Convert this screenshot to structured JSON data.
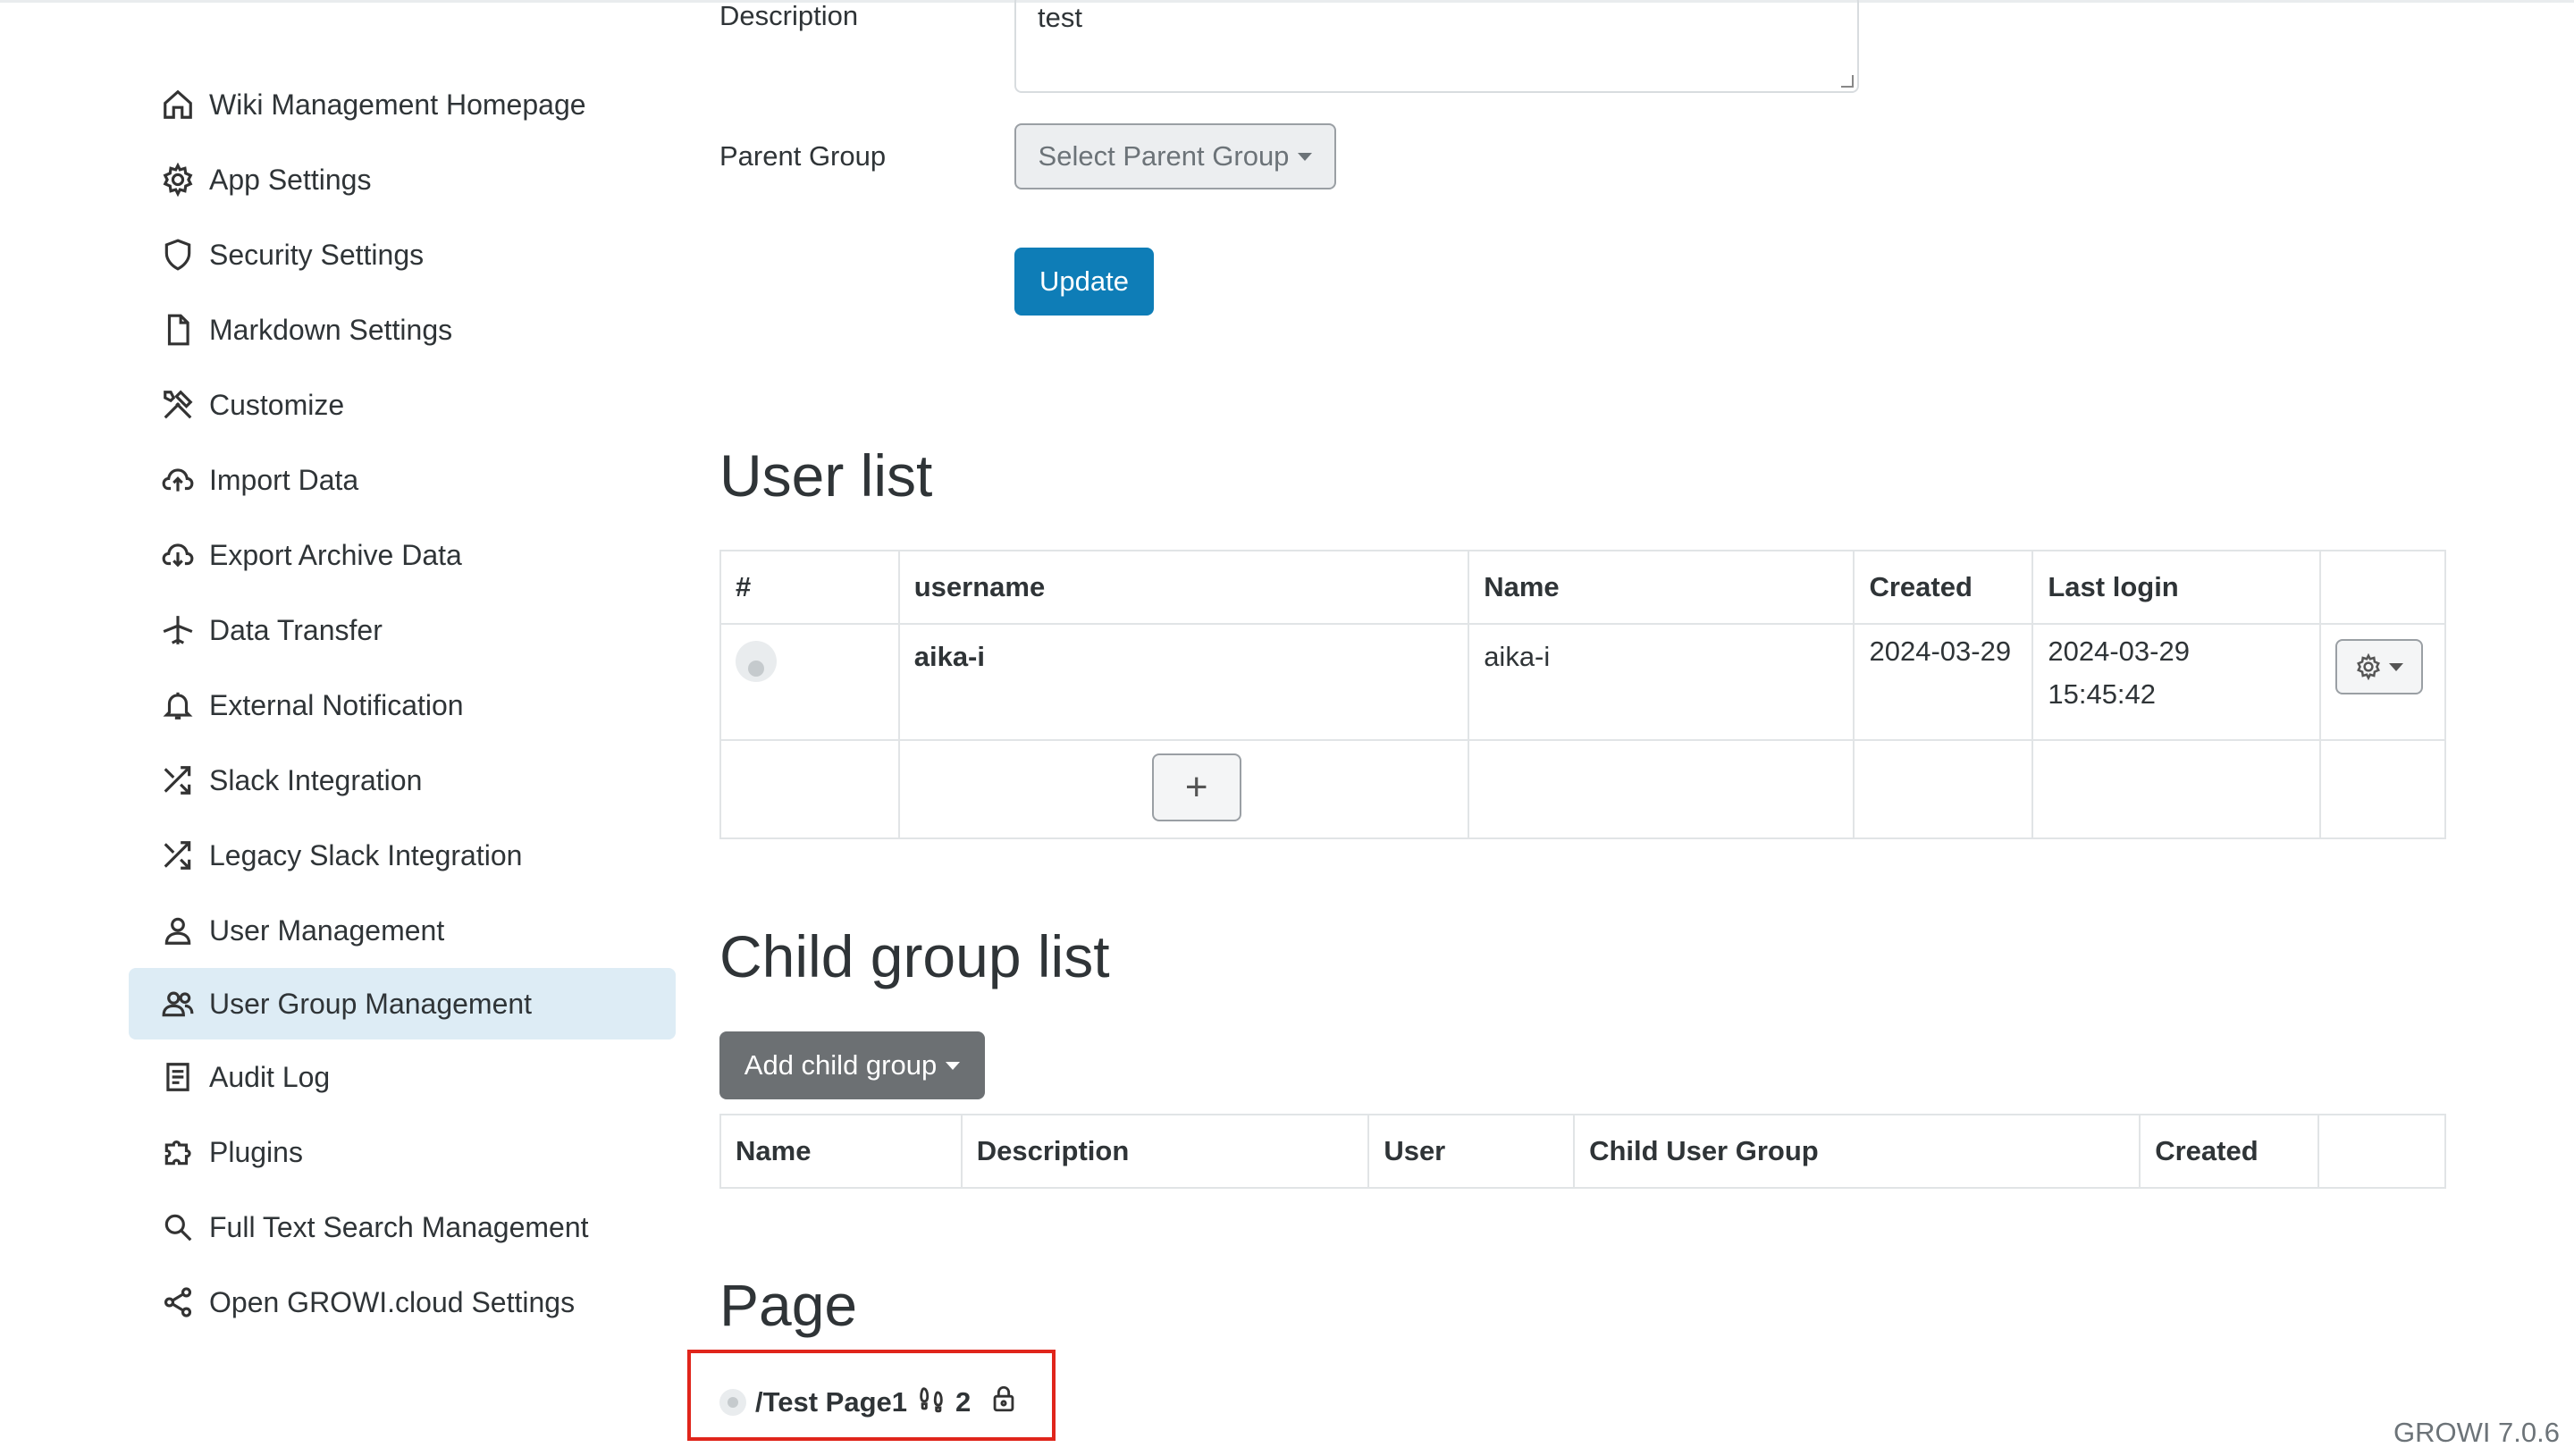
{
  "sidebar": {
    "items": [
      {
        "label": "Wiki Management Homepage",
        "icon": "home-icon"
      },
      {
        "label": "App Settings",
        "icon": "gear-icon"
      },
      {
        "label": "Security Settings",
        "icon": "shield-icon"
      },
      {
        "label": "Markdown Settings",
        "icon": "file-icon"
      },
      {
        "label": "Customize",
        "icon": "tools-icon"
      },
      {
        "label": "Import Data",
        "icon": "cloud-upload-icon"
      },
      {
        "label": "Export Archive Data",
        "icon": "cloud-download-icon"
      },
      {
        "label": "Data Transfer",
        "icon": "airplane-icon"
      },
      {
        "label": "External Notification",
        "icon": "bell-icon"
      },
      {
        "label": "Slack Integration",
        "icon": "shuffle-icon"
      },
      {
        "label": "Legacy Slack Integration",
        "icon": "shuffle-icon"
      },
      {
        "label": "User Management",
        "icon": "person-icon"
      },
      {
        "label": "User Group Management",
        "icon": "people-icon",
        "active": true
      },
      {
        "label": "Audit Log",
        "icon": "journal-icon"
      },
      {
        "label": "Plugins",
        "icon": "puzzle-icon"
      },
      {
        "label": "Full Text Search Management",
        "icon": "search-icon"
      },
      {
        "label": "Open GROWI.cloud Settings",
        "icon": "share-icon"
      }
    ]
  },
  "form": {
    "description_label": "Description",
    "description_value": "test",
    "parent_group_label": "Parent Group",
    "parent_group_select": "Select Parent Group",
    "update_label": "Update"
  },
  "user_list": {
    "title": "User list",
    "headers": [
      "#",
      "username",
      "Name",
      "Created",
      "Last login",
      ""
    ],
    "rows": [
      {
        "username": "aika-i",
        "name": "aika-i",
        "created": "2024-03-29",
        "last_login": "2024-03-29 15:45:42"
      }
    ],
    "add_label": "+"
  },
  "child_group_list": {
    "title": "Child group list",
    "add_button": "Add child group",
    "headers": [
      "Name",
      "Description",
      "User",
      "Child User Group",
      "Created",
      ""
    ]
  },
  "page_section": {
    "title": "Page",
    "page_path": "/Test Page1",
    "footprint_count": "2"
  },
  "footer": {
    "version": "GROWI 7.0.6"
  },
  "colors": {
    "primary": "#0e7db7",
    "active_nav_bg": "#ddecf5",
    "highlight_border": "#e0251b"
  }
}
